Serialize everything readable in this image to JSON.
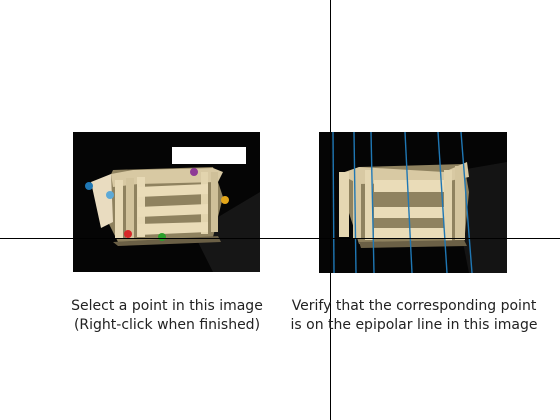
{
  "left_panel": {
    "caption_line1": "Select a point in this image",
    "caption_line2": "(Right-click when finished)",
    "selected_point_colors": [
      "#1f77b4",
      "#5da9d6",
      "#d62728",
      "#2ca02c",
      "#e3a619",
      "#8e3a96"
    ]
  },
  "right_panel": {
    "caption_line1": "Verify that the corresponding point",
    "caption_line2": "is on the epipolar line in this image",
    "epipolar_line_color": "#1f77b4"
  },
  "colors": {
    "background": "#ffffff",
    "image_background": "#050505",
    "crosshair": "#000000",
    "temple_stone": "#d8c9a3"
  }
}
